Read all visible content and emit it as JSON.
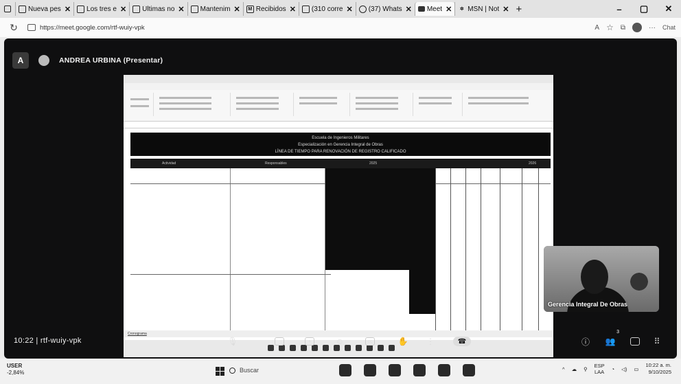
{
  "browser": {
    "tabs": [
      {
        "label": "Nueva pes",
        "icon": "new-tab-icon"
      },
      {
        "label": "Los tres e",
        "icon": "document-icon"
      },
      {
        "label": "Últimas no",
        "icon": "news-icon"
      },
      {
        "label": "Mantenim",
        "icon": "page-icon"
      },
      {
        "label": "Recibidos",
        "icon": "gmail-icon"
      },
      {
        "label": "(310 corre",
        "icon": "mail-icon"
      },
      {
        "label": "(37) Whats",
        "icon": "whatsapp-icon"
      },
      {
        "label": "Meet",
        "icon": "meet-icon",
        "active": true
      },
      {
        "label": "MSN | Not",
        "icon": "msn-icon"
      }
    ],
    "new_tab_label": "+",
    "url": "https://meet.google.com/rtf-wuiy-vpk",
    "right_label": "Chat"
  },
  "meet": {
    "presenter_label": "ANDREA URBINA (Presentar)",
    "time_and_code": "10:22 | rtf-wuiy-vpk",
    "participant_tile_name": "Gerencia Integral De Obras",
    "participants_count": "3"
  },
  "shared_sheet": {
    "banner_line1": "Escuela de Ingenieros Militares",
    "banner_line2": "Especialización en Gerencia Integral de Obras",
    "banner_line3": "LÍNEA DE TIEMPO PARA RENOVACIÓN DE REGISTRO CALIFICADO",
    "col_header_activity": "Actividad",
    "col_header_responsible": "Responsables",
    "year_a": "2025",
    "year_b": "2026",
    "sheet_tab_1": "Cronograma"
  },
  "taskbar": {
    "ticker_name": "USER",
    "ticker_value": "-2,84%",
    "search_placeholder": "Buscar",
    "lang_line1": "ESP",
    "lang_line2": "LAA",
    "clock_time": "10:22 a. m.",
    "clock_date": "9/10/2025"
  }
}
